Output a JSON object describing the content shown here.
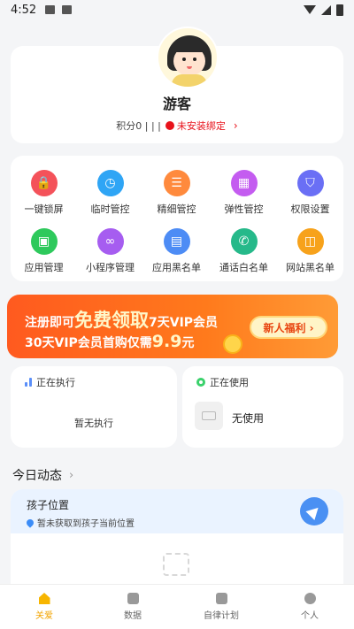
{
  "status_bar": {
    "time": "4:52"
  },
  "profile": {
    "nickname": "游客",
    "score_text": "积分0 | | |",
    "bind_text": "未安装绑定",
    "chevron": "›"
  },
  "menu": {
    "items": [
      {
        "label": "一键锁屏",
        "icon": "lock-icon",
        "color": "#f4525a",
        "glyph": "🔒"
      },
      {
        "label": "临时管控",
        "icon": "timer-icon",
        "color": "#2fa5f5",
        "glyph": "◷"
      },
      {
        "label": "精细管控",
        "icon": "sliders-icon",
        "color": "#ff8a3d",
        "glyph": "☰"
      },
      {
        "label": "弹性管控",
        "icon": "calendar-icon",
        "color": "#c45cf0",
        "glyph": "▦"
      },
      {
        "label": "权限设置",
        "icon": "shield-icon",
        "color": "#6a6ff5",
        "glyph": "⛉"
      },
      {
        "label": "应用管理",
        "icon": "apps-icon",
        "color": "#2ec95c",
        "glyph": "▣"
      },
      {
        "label": "小程序管理",
        "icon": "link-icon",
        "color": "#a65df0",
        "glyph": "∞"
      },
      {
        "label": "应用黑名单",
        "icon": "grid-icon",
        "color": "#4d8cf5",
        "glyph": "▤"
      },
      {
        "label": "通话白名单",
        "icon": "phone-icon",
        "color": "#26b98a",
        "glyph": "✆"
      },
      {
        "label": "网站黑名单",
        "icon": "web-icon",
        "color": "#f7a21b",
        "glyph": "◫"
      }
    ]
  },
  "banner": {
    "line1_a": "注册即可",
    "line1_big": "免费领取",
    "line1_b": "7天VIP会员",
    "line2_a": "30天VIP会员首购仅需",
    "line2_price": "9.9",
    "line2_b": "元",
    "button": "新人福利 ›"
  },
  "executing": {
    "title": "正在执行",
    "empty": "暂无执行"
  },
  "in_use": {
    "title": "正在使用",
    "value": "无使用"
  },
  "today": {
    "title": "今日动态",
    "chevron": "›",
    "location_title": "孩子位置",
    "location_sub": "暂未获取到孩子当前位置"
  },
  "tabs": [
    {
      "label": "关爱",
      "active": true,
      "icon": "home-icon"
    },
    {
      "label": "数据",
      "active": false,
      "icon": "chart-icon"
    },
    {
      "label": "自律计划",
      "active": false,
      "icon": "plan-icon"
    },
    {
      "label": "个人",
      "active": false,
      "icon": "person-icon"
    }
  ],
  "colors": {
    "accent": "#f7b500",
    "banner": "#ff6a1f",
    "alert": "#e8121b"
  }
}
